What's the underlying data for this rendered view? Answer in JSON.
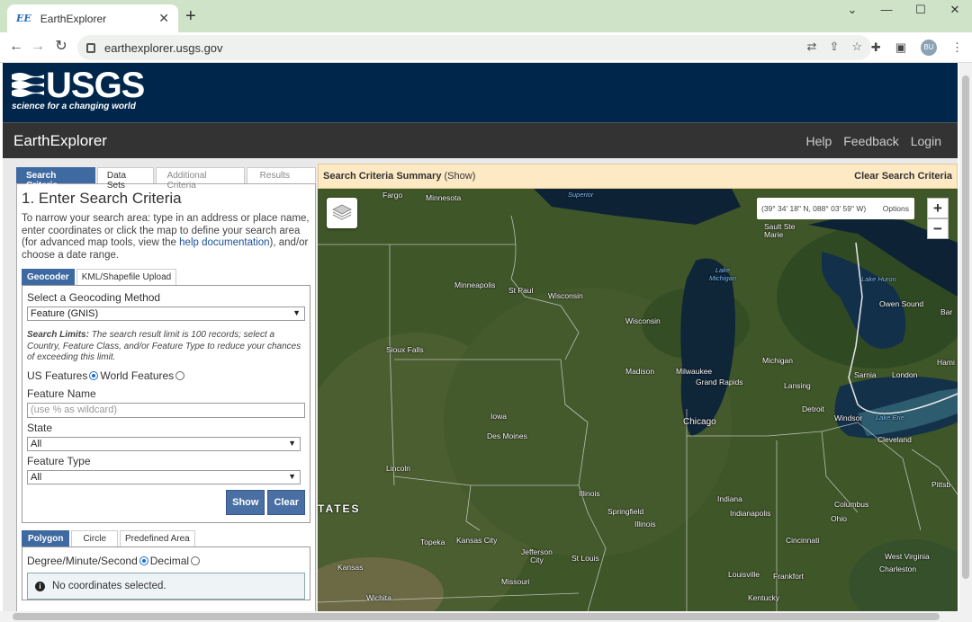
{
  "browser": {
    "tab_favicon": "EE",
    "tab_title": "EarthExplorer",
    "tab_close": "✕",
    "new_tab": "+",
    "window_controls": [
      "⌄",
      "—",
      "☐",
      "✕"
    ],
    "back": "←",
    "forward": "→",
    "reload": "↻",
    "url": "earthexplorer.usgs.gov",
    "profile": "BU"
  },
  "header": {
    "logo_text": "USGS",
    "logo_tagline": "science for a changing world",
    "app_title": "EarthExplorer",
    "links": [
      "Help",
      "Feedback",
      "Login"
    ]
  },
  "left_panel": {
    "tabs": [
      "Search Criteria",
      "Data Sets",
      "Additional Criteria",
      "Results"
    ],
    "heading": "1. Enter Search Criteria",
    "intro_before": "To narrow your search area: type in an address or place name, enter coordinates or click the map to define your search area (for advanced map tools, view the ",
    "intro_link": "help documentation",
    "intro_after": "), and/or choose a date range.",
    "subtabs": [
      "Geocoder",
      "KML/Shapefile Upload"
    ],
    "geocoding_label": "Select a Geocoding Method",
    "geocoding_value": "Feature (GNIS)",
    "limits_bold": "Search Limits:",
    "limits_text": " The search result limit is 100 records; select a Country, Feature Class, and/or Feature Type to reduce your chances of exceeding this limit.",
    "us_features": "US Features",
    "world_features": "World Features",
    "feature_name_label": "Feature Name",
    "feature_name_placeholder": "(use % as wildcard)",
    "state_label": "State",
    "state_value": "All",
    "feature_type_label": "Feature Type",
    "feature_type_value": "All",
    "show_button": "Show",
    "clear_button": "Clear",
    "area_tabs": [
      "Polygon",
      "Circle",
      "Predefined Area"
    ],
    "dms_label": "Degree/Minute/Second",
    "decimal_label": "Decimal",
    "no_coords": "No coordinates selected."
  },
  "map_panel": {
    "summary_label": "Search Criteria Summary",
    "summary_show": "(Show)",
    "clear_label": "Clear Search Criteria",
    "coords": "(39° 34' 18\" N, 088° 03' 59\" W)",
    "options": "Options",
    "zoom_in": "+",
    "zoom_out": "−",
    "labels": {
      "fargo": "Fargo",
      "minnesota": "Minnesota",
      "superior": "Superior",
      "sault_ste_marie": "Sault Ste\nMarie",
      "minneapolis": "Minneapolis",
      "st_paul": "St Paul",
      "wisconsin1": "Wisconsin",
      "lake_michigan": "Lake\nMichigan",
      "lake_huron": "Lake Huron",
      "owen_sound": "Owen Sound",
      "barrie": "Bar",
      "wisconsin2": "Wisconsin",
      "sioux_falls": "Sioux Falls",
      "madison": "Madison",
      "milwaukee": "Milwaukee",
      "grand_rapids": "Grand Rapids",
      "michigan": "Michigan",
      "sarnia": "Sarnia",
      "london": "London",
      "hamilton": "Hami",
      "lansing": "Lansing",
      "iowa": "Iowa",
      "detroit": "Detroit",
      "windsor": "Windsor",
      "lake_erie": "Lake Erie",
      "chicago": "Chicago",
      "des_moines": "Des Moines",
      "cleveland": "Cleveland",
      "lincoln": "Lincoln",
      "illinois": "Illinois",
      "indiana": "Indiana",
      "pittsburgh": "Pittsb",
      "states": "TATES",
      "springfield": "Springfield",
      "illinois2": "Illinois",
      "indianapolis": "Indianapolis",
      "columbus": "Columbus",
      "ohio": "Ohio",
      "topeka": "Topeka",
      "kansas_city": "Kansas City",
      "jefferson_city": "Jefferson\nCity",
      "st_louis": "St Louis",
      "cincinnati": "Cincinnati",
      "west_virginia": "West Virginia",
      "kansas": "Kansas",
      "missouri": "Missouri",
      "louisville": "Louisville",
      "frankfort": "Frankfort",
      "charleston": "Charleston",
      "wichita": "Wichita",
      "kentucky": "Kentucky"
    }
  }
}
